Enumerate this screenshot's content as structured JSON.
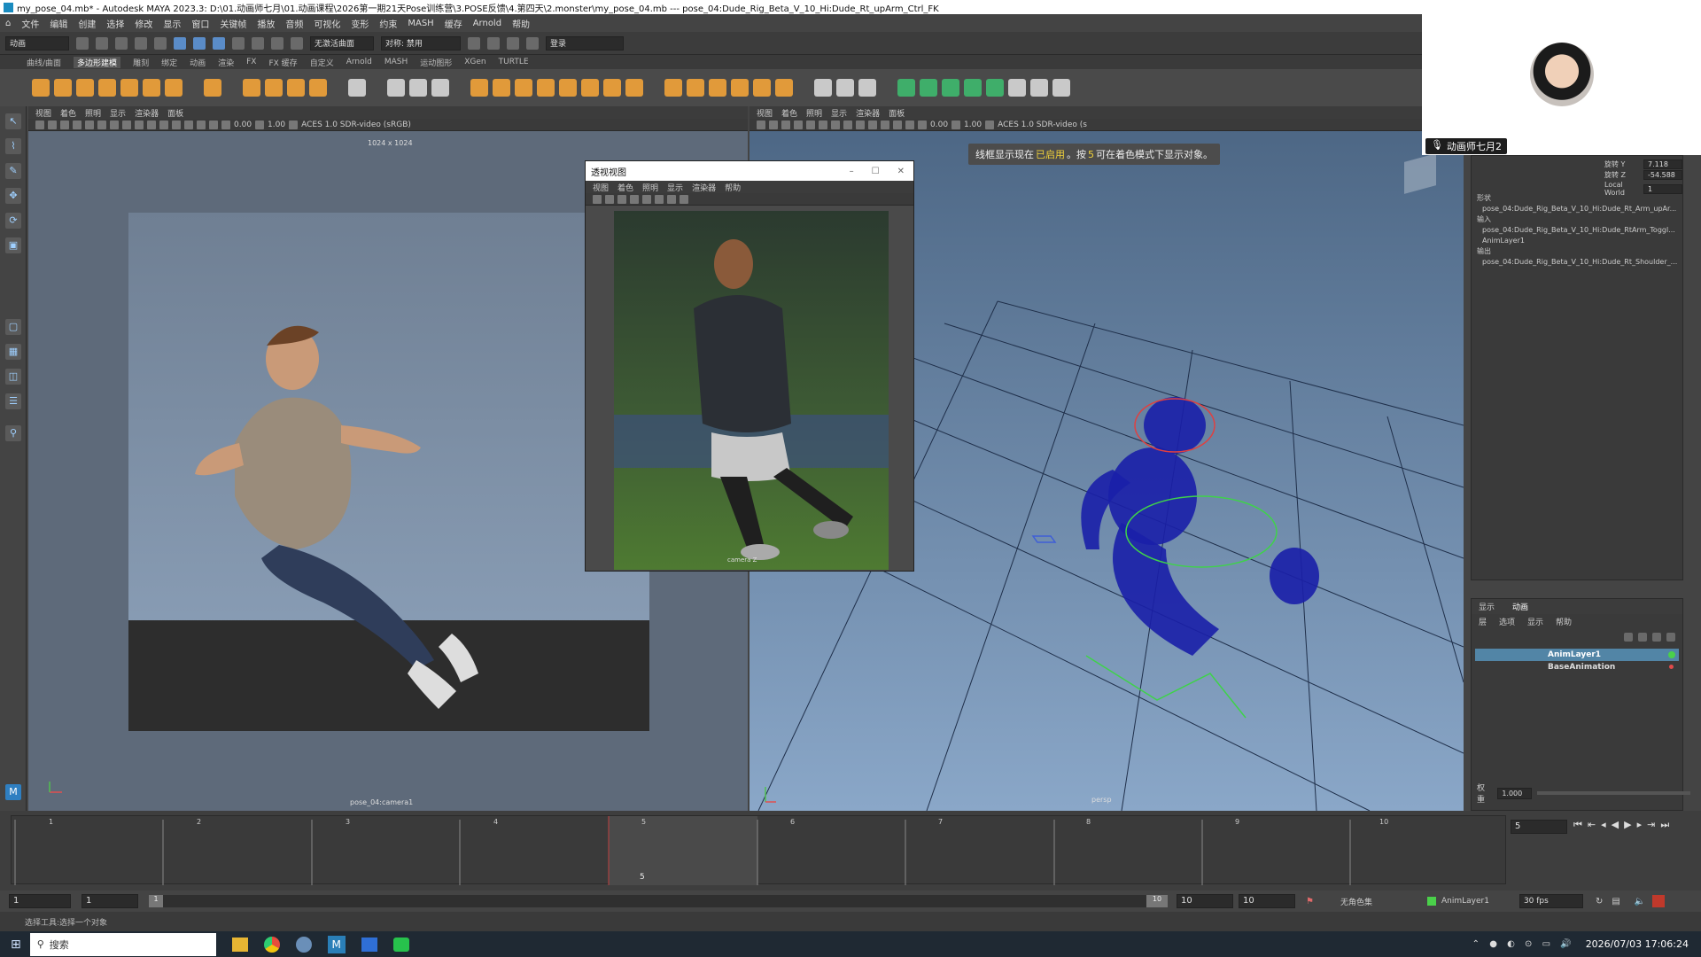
{
  "window": {
    "title": "my_pose_04.mb* - Autodesk MAYA 2023.3: D:\\01.动画师七月\\01.动画课程\\2026第一期21天Pose训练营\\3.POSE反馈\\4.第四天\\2.monster\\my_pose_04.mb   ---   pose_04:Dude_Rig_Beta_V_10_Hi:Dude_Rt_upArm_Ctrl_FK"
  },
  "menubar": [
    "文件",
    "编辑",
    "创建",
    "选择",
    "修改",
    "显示",
    "窗口",
    "关键帧",
    "播放",
    "音频",
    "可视化",
    "变形",
    "约束",
    "MASH",
    "缓存",
    "Arnold",
    "帮助"
  ],
  "statusline": {
    "mode": "动画",
    "curve": "无激活曲面",
    "symmetry": "对称: 禁用",
    "login": "登录"
  },
  "shelf_tabs": [
    "曲线/曲面",
    "多边形建模",
    "雕刻",
    "绑定",
    "动画",
    "渲染",
    "FX",
    "FX 缓存",
    "自定义",
    "Arnold",
    "MASH",
    "运动图形",
    "XGen",
    "TURTLE"
  ],
  "shelf_active": "多边形建模",
  "viewport_menu": [
    "视图",
    "着色",
    "照明",
    "显示",
    "渲染器",
    "面板"
  ],
  "left_viewport": {
    "exposure": "0.00",
    "gamma": "1.00",
    "colorspace": "ACES 1.0 SDR-video (sRGB)",
    "resolution": "1024 x 1024",
    "camera": "pose_04:camera1"
  },
  "right_viewport": {
    "exposure": "0.00",
    "gamma": "1.00",
    "colorspace": "ACES 1.0 SDR-video (s",
    "hint_prefix": "线框显示现在",
    "hint_on": "已启用",
    "hint_mid": "。按",
    "hint_key": "5",
    "hint_suffix": "可在着色模式下显示对象。",
    "camera": "persp"
  },
  "ref_window": {
    "title": "透视视图",
    "menu": [
      "视图",
      "着色",
      "照明",
      "显示",
      "渲染器",
      "帮助"
    ],
    "watermark": "camera Z"
  },
  "webcam": {
    "name": "动画师七月2"
  },
  "channel_box": {
    "rotate_y_label": "旋转 Y",
    "rotate_y": "7.118",
    "rotate_z_label": "旋转 Z",
    "rotate_z": "-54.588",
    "local_world_label": "Local World",
    "local_world": "1",
    "shape_label": "形状",
    "shape_item": "pose_04:Dude_Rig_Beta_V_10_Hi:Dude_Rt_Arm_upAr...",
    "input_label": "输入",
    "input_item1": "pose_04:Dude_Rig_Beta_V_10_Hi:Dude_RtArm_Toggl...",
    "input_item2": "AnimLayer1",
    "output_label": "输出",
    "output_item": "pose_04:Dude_Rig_Beta_V_10_Hi:Dude_Rt_Shoulder_..."
  },
  "layer_editor": {
    "tabs": [
      "显示",
      "动画"
    ],
    "menu": [
      "层",
      "选项",
      "显示",
      "帮助"
    ],
    "layers": [
      "AnimLayer1",
      "BaseAnimation"
    ],
    "weight_label": "权重",
    "weight": "1.000"
  },
  "timeline": {
    "ticks": [
      "1",
      "2",
      "3",
      "4",
      "5",
      "6",
      "7",
      "8",
      "9",
      "10"
    ],
    "current_frame_marker": "5",
    "current_frame_field": "5"
  },
  "range": {
    "start": "1",
    "start_inner": "1",
    "slider_start": "1",
    "slider_end": "10",
    "end_inner": "10",
    "end": "10",
    "char_set": "无角色集",
    "anim_layer": "AnimLayer1",
    "fps": "30 fps"
  },
  "cmdline": {
    "hint": "选择工具:选择一个对象"
  },
  "taskbar": {
    "search": "搜索",
    "datetime": "2026/07/03 17:06:24"
  },
  "colors": {
    "accent": "#5285a6",
    "wire": "#1a1fa8",
    "hint_yellow": "#f2d23a"
  }
}
